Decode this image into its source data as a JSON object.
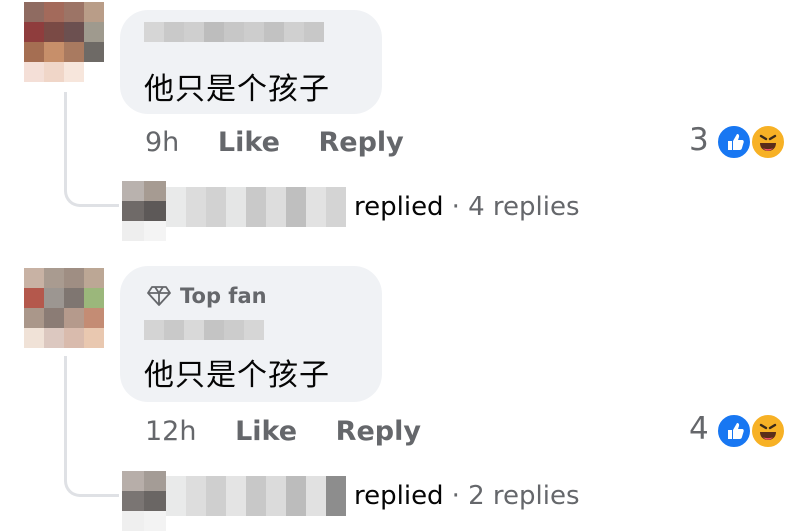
{
  "comments": [
    {
      "text": "他只是个孩子",
      "time": "9h",
      "like_label": "Like",
      "reply_label": "Reply",
      "reaction_count": "3",
      "replies_text": "replied",
      "replies_count": "· 4 replies"
    },
    {
      "badge": "Top fan",
      "text": "他只是个孩子",
      "time": "12h",
      "like_label": "Like",
      "reply_label": "Reply",
      "reaction_count": "4",
      "replies_text": "replied",
      "replies_count": "· 2 replies"
    }
  ],
  "reactions": [
    "like-icon",
    "haha-icon"
  ],
  "colors": {
    "like": "#1877f2",
    "haha": "#f7b125",
    "bubble": "#f0f2f5",
    "meta": "#65676b"
  }
}
